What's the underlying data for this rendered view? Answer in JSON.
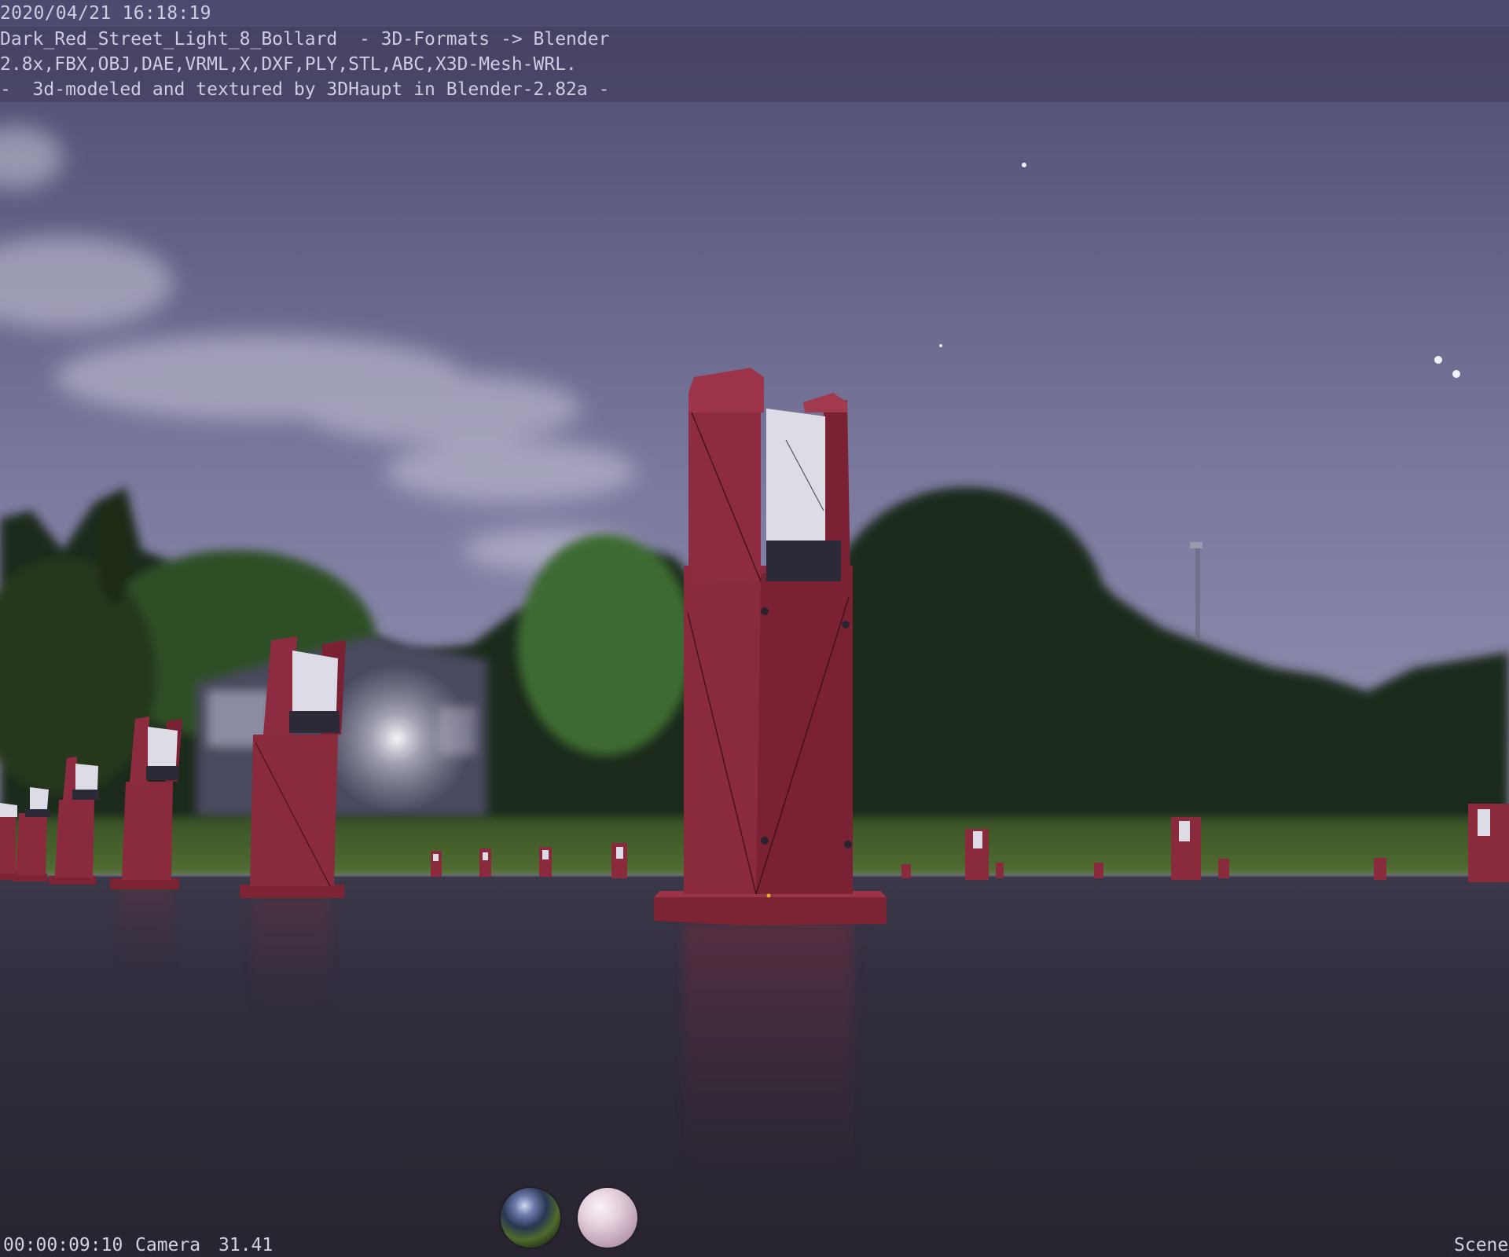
{
  "overlay": {
    "timestamp": "2020/04/21 16:18:19",
    "notes": [
      "Dark_Red_Street_Light_8_Bollard  - 3D-Formats -> Blender",
      "2.8x,FBX,OBJ,DAE,VRML,X,DXF,PLY,STL,ABC,X3D-Mesh-WRL.",
      "-  3d-modeled and textured by 3DHaupt in Blender-2.82a -"
    ]
  },
  "footer": {
    "timecode": "00:00:09:10",
    "camera_label": "Camera",
    "lens_value": "31.41",
    "scene_label": "Scene"
  },
  "colors": {
    "sky_top": "#5c5a80",
    "sky_bottom": "#8c8aab",
    "ground": "#2d2a37",
    "bollard_red": "#8a2a3d",
    "bollard_dark": "#6e1f30",
    "lamp_glass": "#d8d8e2",
    "foliage": "#2a3a22"
  },
  "icons": [
    "hdri-preview-sphere",
    "material-preview-sphere"
  ]
}
